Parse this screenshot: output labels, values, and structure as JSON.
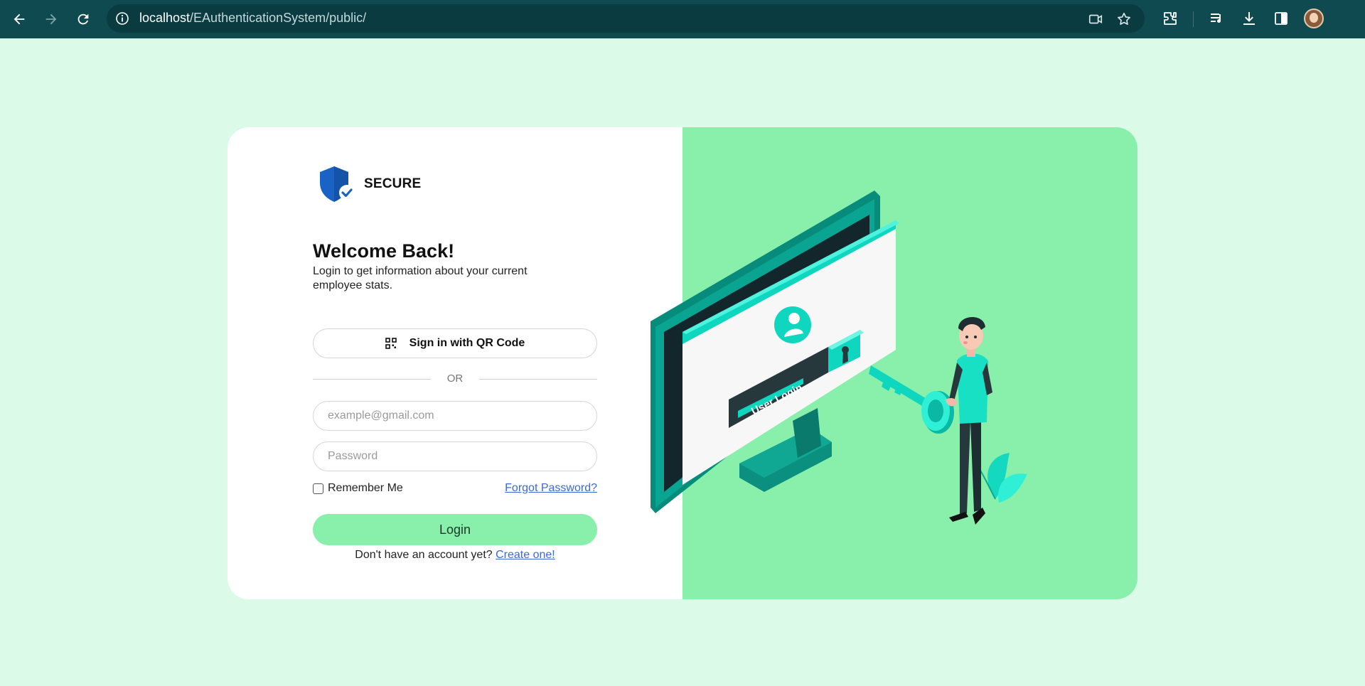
{
  "browser": {
    "url_host": "localhost",
    "url_path": "/EAuthenticationSystem/public/",
    "icons": [
      "back-icon",
      "forward-icon",
      "reload-icon",
      "site-info-icon",
      "camera-icon",
      "star-icon",
      "extensions-icon",
      "media-icon",
      "download-icon",
      "side-panel-icon",
      "avatar"
    ]
  },
  "brand": {
    "name": "SECURE",
    "color": "#1a62c4"
  },
  "login": {
    "title": "Welcome Back!",
    "subtitle": "Login to get information about your current employee stats.",
    "qr_label": "Sign in with QR Code",
    "or_label": "OR",
    "email_placeholder": "example@gmail.com",
    "password_placeholder": "Password",
    "remember_label": "Remember Me",
    "forgot_label": "Forgot Password?",
    "login_label": "Login",
    "signup_prompt": "Don't have an account yet?",
    "signup_link": "Create one!"
  },
  "illustration": {
    "screen_label": "User Login"
  },
  "colors": {
    "page_bg": "#dcfae8",
    "accent_green": "#88f0aa",
    "teal": "#0ed6bf",
    "link": "#3b6ad6"
  }
}
